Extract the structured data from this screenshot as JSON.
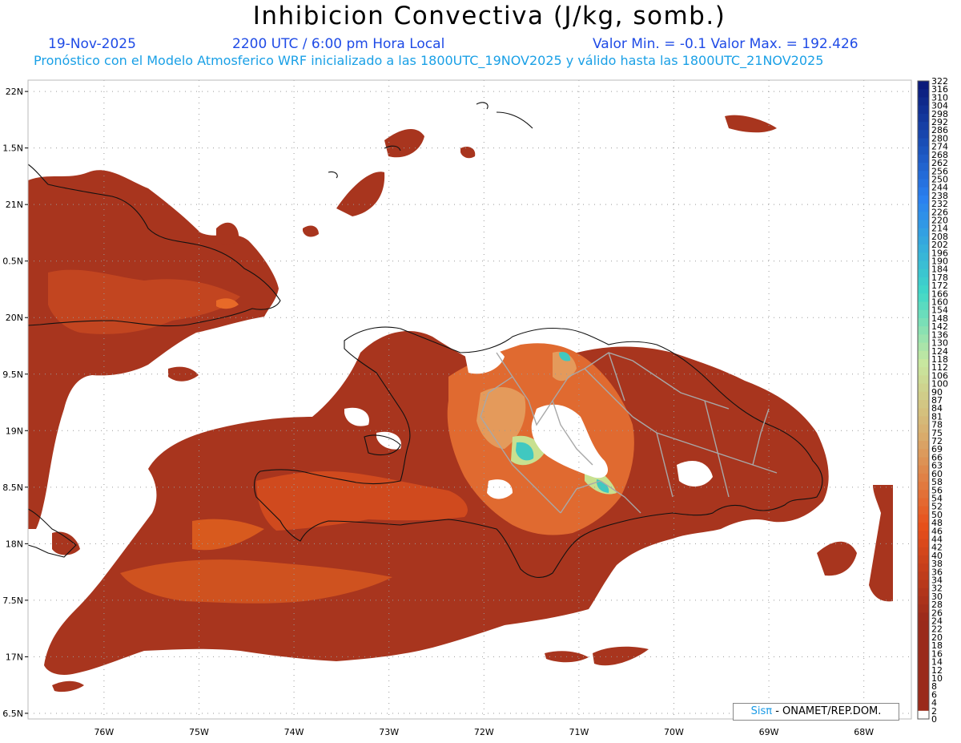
{
  "header": {
    "title": "Inhibicion Convectiva (J/kg, somb.)",
    "date": "19-Nov-2025",
    "time": "2200 UTC / 6:00 pm Hora Local",
    "stats": "Valor Min. = -0.1  Valor Max. = 192.426",
    "model_info": "Pronóstico con el Modelo Atmosferico WRF inicializado a las 1800UTC_19NOV2025 y válido hasta las  1800UTC_21NOV2025"
  },
  "map": {
    "lat_labels": [
      "22N",
      "1.5N",
      "21N",
      "0.5N",
      "20N",
      "9.5N",
      "19N",
      "8.5N",
      "18N",
      "7.5N",
      "17N",
      "6.5N"
    ],
    "lon_labels": [
      "76W",
      "75W",
      "74W",
      "73W",
      "72W",
      "71W",
      "70W",
      "69W",
      "68W"
    ],
    "lat_values": [
      22,
      21.5,
      21,
      20.5,
      20,
      19.5,
      19,
      18.5,
      18,
      17.5,
      17,
      16.5
    ],
    "lon_values": [
      -76,
      -75,
      -74,
      -73,
      -72,
      -71,
      -70,
      -69,
      -68
    ],
    "extent": {
      "lon_min": -76.8,
      "lon_max": -67.5,
      "lat_min": 16.45,
      "lat_max": 22.1
    },
    "grid": "dotted"
  },
  "colorbar": {
    "labels": [
      "322",
      "316",
      "310",
      "304",
      "298",
      "292",
      "286",
      "280",
      "274",
      "268",
      "262",
      "256",
      "250",
      "244",
      "238",
      "232",
      "226",
      "220",
      "214",
      "208",
      "202",
      "196",
      "190",
      "184",
      "178",
      "172",
      "166",
      "160",
      "154",
      "148",
      "142",
      "136",
      "130",
      "124",
      "118",
      "112",
      "106",
      "100",
      "90",
      "87",
      "84",
      "81",
      "78",
      "75",
      "72",
      "69",
      "66",
      "63",
      "60",
      "58",
      "56",
      "54",
      "52",
      "50",
      "48",
      "46",
      "44",
      "42",
      "40",
      "38",
      "36",
      "34",
      "32",
      "30",
      "28",
      "26",
      "24",
      "22",
      "20",
      "18",
      "16",
      "14",
      "12",
      "10",
      "8",
      "6",
      "4",
      "2",
      "0"
    ],
    "colors": {
      "low": "#9a2a1a",
      "mid_low": "#e8501a",
      "mid": "#d8b070",
      "mid_high": "#c8e8a0",
      "cyan": "#40d8c8",
      "blue": "#2a80f0",
      "high": "#0a1a7a",
      "zero": "#ffffff"
    }
  },
  "credit": {
    "logo": "Sisπ",
    "text": "- ONAMET/REP.DOM."
  }
}
